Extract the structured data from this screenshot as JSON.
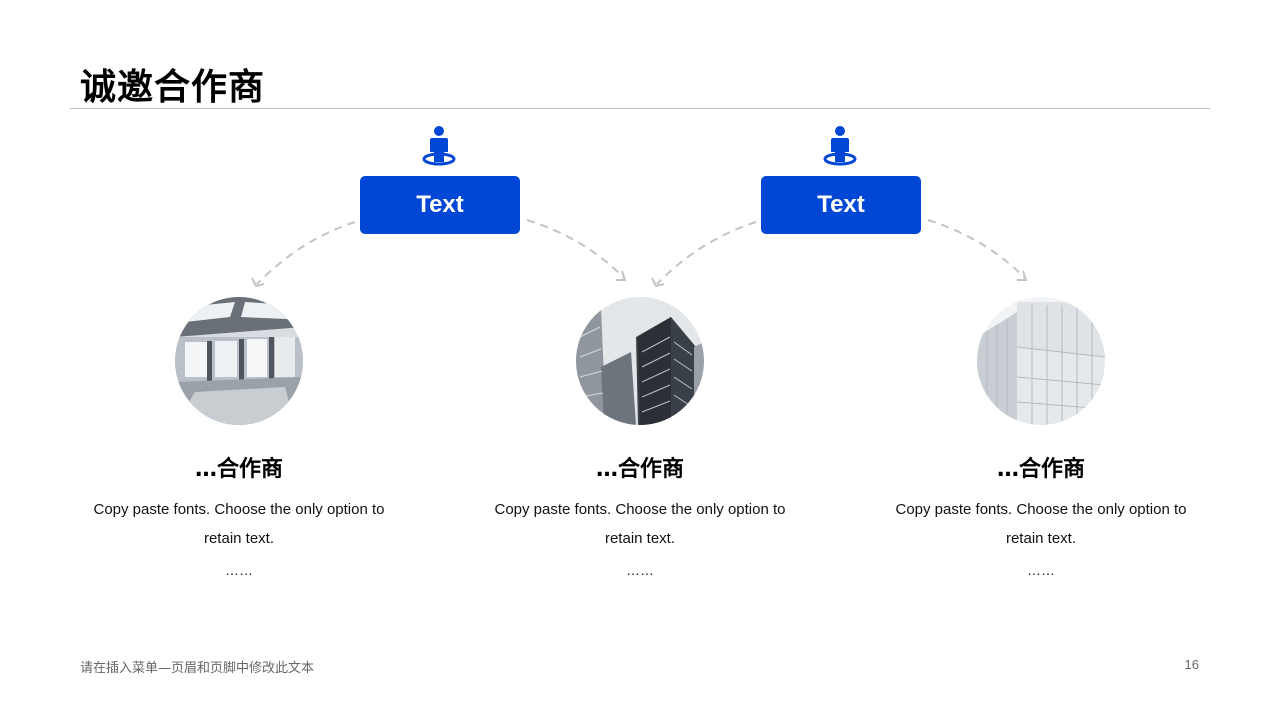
{
  "header": {
    "title": "诚邀合作商"
  },
  "nodes": [
    {
      "label": "Text"
    },
    {
      "label": "Text"
    }
  ],
  "partners": [
    {
      "title": "…合作商",
      "description": "Copy paste fonts. Choose the only option to retain text.",
      "ellipsis": "……",
      "image": "interior-glass-building-photo"
    },
    {
      "title": "…合作商",
      "description": "Copy paste fonts. Choose the only option to retain text.",
      "ellipsis": "……",
      "image": "skyscrapers-photo"
    },
    {
      "title": "…合作商",
      "description": "Copy paste fonts. Choose the only option to retain text.",
      "ellipsis": "……",
      "image": "white-facade-building-photo"
    }
  ],
  "footer": {
    "note": "请在插入菜单—页眉和页脚中修改此文本",
    "page_number": "16"
  },
  "colors": {
    "accent": "#0047d6",
    "arrow": "#c4c4c4",
    "rule": "#bdbdbd"
  },
  "icons": {
    "node_icon": "person-on-pin-icon"
  }
}
